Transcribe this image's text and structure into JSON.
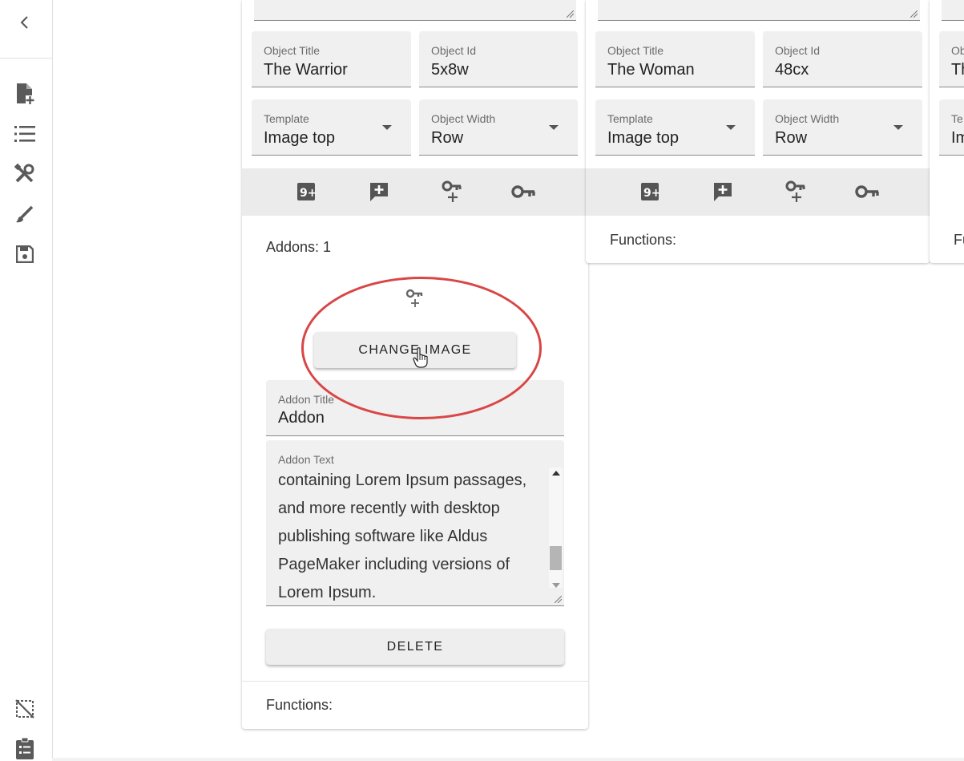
{
  "rail": {
    "icons": [
      "chevron-left-icon",
      "file-add-icon",
      "list-icon",
      "tools-icon",
      "brush-icon",
      "save-icon",
      "select-off-icon",
      "clipboard-list-icon"
    ]
  },
  "columns": [
    {
      "object_title_label": "Object Title",
      "object_title": "The Warrior",
      "object_id_label": "Object Id",
      "object_id": "5x8w",
      "template_label": "Template",
      "template": "Image top",
      "width_label": "Object Width",
      "width": "Row",
      "addons_count": "Addons: 1",
      "change_image": "CHANGE IMAGE",
      "addon_title_label": "Addon Title",
      "addon_title": "Addon",
      "addon_text_label": "Addon Text",
      "addon_text": "containing Lorem Ipsum passages, and more recently with desktop publishing software like Aldus PageMaker including versions of Lorem Ipsum.",
      "delete": "DELETE",
      "functions": "Functions:"
    },
    {
      "object_title_label": "Object Title",
      "object_title": "The Woman",
      "object_id_label": "Object Id",
      "object_id": "48cx",
      "template_label": "Template",
      "template": "Image top",
      "width_label": "Object Width",
      "width": "Row",
      "functions": "Functions:"
    },
    {
      "object_title_label": "Ob",
      "object_title": "Th",
      "template_label": "Te",
      "template": "Im",
      "functions": "Fu"
    }
  ]
}
